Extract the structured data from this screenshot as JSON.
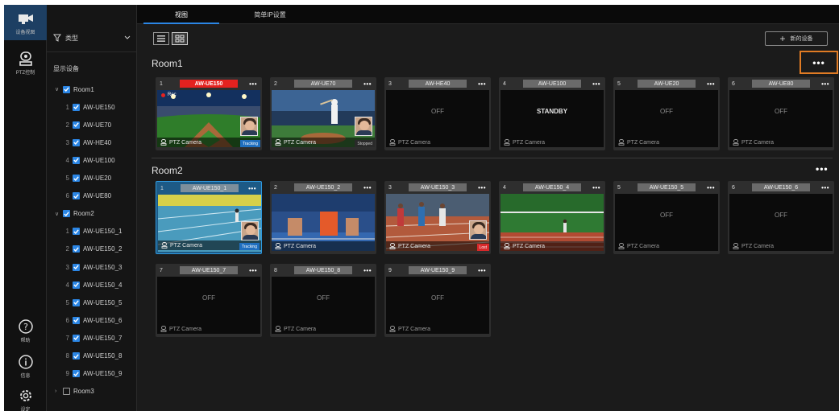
{
  "rail": {
    "camera_label": "设备视图",
    "ptz_label": "PTZ控制",
    "help_label": "帮助",
    "info_label": "信息",
    "settings_label": "设定"
  },
  "tabs": {
    "view": "视图",
    "ip": "简单IP设置"
  },
  "panel": {
    "filter_label": "类型",
    "title": "显示设备",
    "tree": [
      {
        "kind": "group",
        "label": "Room1",
        "checked": true,
        "expanded": true
      },
      {
        "kind": "item",
        "num": "1",
        "label": "AW-UE150",
        "checked": true
      },
      {
        "kind": "item",
        "num": "2",
        "label": "AW-UE70",
        "checked": true
      },
      {
        "kind": "item",
        "num": "3",
        "label": "AW-HE40",
        "checked": true
      },
      {
        "kind": "item",
        "num": "4",
        "label": "AW-UE100",
        "checked": true
      },
      {
        "kind": "item",
        "num": "5",
        "label": "AW-UE20",
        "checked": true
      },
      {
        "kind": "item",
        "num": "6",
        "label": "AW-UE80",
        "checked": true
      },
      {
        "kind": "group",
        "label": "Room2",
        "checked": true,
        "expanded": true
      },
      {
        "kind": "item",
        "num": "1",
        "label": "AW-UE150_1",
        "checked": true
      },
      {
        "kind": "item",
        "num": "2",
        "label": "AW-UE150_2",
        "checked": true
      },
      {
        "kind": "item",
        "num": "3",
        "label": "AW-UE150_3",
        "checked": true
      },
      {
        "kind": "item",
        "num": "4",
        "label": "AW-UE150_4",
        "checked": true
      },
      {
        "kind": "item",
        "num": "5",
        "label": "AW-UE150_5",
        "checked": true
      },
      {
        "kind": "item",
        "num": "6",
        "label": "AW-UE150_6",
        "checked": true
      },
      {
        "kind": "item",
        "num": "7",
        "label": "AW-UE150_7",
        "checked": true
      },
      {
        "kind": "item",
        "num": "8",
        "label": "AW-UE150_8",
        "checked": true
      },
      {
        "kind": "item",
        "num": "9",
        "label": "AW-UE150_9",
        "checked": true
      },
      {
        "kind": "group",
        "label": "Room3",
        "checked": false,
        "expanded": false
      }
    ]
  },
  "toolbar": {
    "add_label": "新的设备"
  },
  "groups": [
    {
      "title": "Room1",
      "more": "•••",
      "cards": [
        {
          "num": "1",
          "name": "AW-UE150",
          "state": "rec",
          "rec_label": "Rec",
          "scene": "baseball",
          "tag": "Tracking",
          "face": true,
          "type_label": "PTZ Camera"
        },
        {
          "num": "2",
          "name": "AW-UE70",
          "state": "live",
          "scene": "batter",
          "tag": "Stopped",
          "face": true,
          "type_label": "PTZ Camera"
        },
        {
          "num": "3",
          "name": "AW-HE40",
          "state": "off",
          "screen_text": "OFF",
          "type_label": "PTZ Camera"
        },
        {
          "num": "4",
          "name": "AW-UE100",
          "state": "standby",
          "screen_text": "STANDBY",
          "type_label": "PTZ Camera"
        },
        {
          "num": "5",
          "name": "AW-UE20",
          "state": "off",
          "screen_text": "OFF",
          "type_label": "PTZ Camera"
        },
        {
          "num": "6",
          "name": "AW-UE80",
          "state": "off",
          "screen_text": "OFF",
          "type_label": "PTZ Camera"
        }
      ]
    },
    {
      "title": "Room2",
      "more": "•••",
      "cards": [
        {
          "num": "1",
          "name": "AW-UE150_1",
          "state": "live",
          "selected": true,
          "scene": "track-runner",
          "tag": "Tracking",
          "face": true,
          "type_label": "PTZ Camera"
        },
        {
          "num": "2",
          "name": "AW-UE150_2",
          "state": "live",
          "scene": "sprint-start",
          "type_label": "PTZ Camera"
        },
        {
          "num": "3",
          "name": "AW-UE150_3",
          "state": "live",
          "scene": "race",
          "tag": "Lost",
          "face": true,
          "type_label": "PTZ Camera"
        },
        {
          "num": "4",
          "name": "AW-UE150_4",
          "state": "live",
          "scene": "field",
          "type_label": "PTZ Camera"
        },
        {
          "num": "5",
          "name": "AW-UE150_5",
          "state": "off",
          "screen_text": "OFF",
          "type_label": "PTZ Camera"
        },
        {
          "num": "6",
          "name": "AW-UE150_6",
          "state": "off",
          "screen_text": "OFF",
          "type_label": "PTZ Camera"
        },
        {
          "num": "7",
          "name": "AW-UE150_7",
          "state": "off",
          "screen_text": "OFF",
          "type_label": "PTZ Camera"
        },
        {
          "num": "8",
          "name": "AW-UE150_8",
          "state": "off",
          "screen_text": "OFF",
          "type_label": "PTZ Camera"
        },
        {
          "num": "9",
          "name": "AW-UE150_9",
          "state": "off",
          "screen_text": "OFF",
          "type_label": "PTZ Camera"
        }
      ]
    }
  ],
  "colors": {
    "accent": "#2b86e5",
    "rec": "#e4221f",
    "highlight": "#e07b24",
    "selected": "#1d5a86"
  }
}
